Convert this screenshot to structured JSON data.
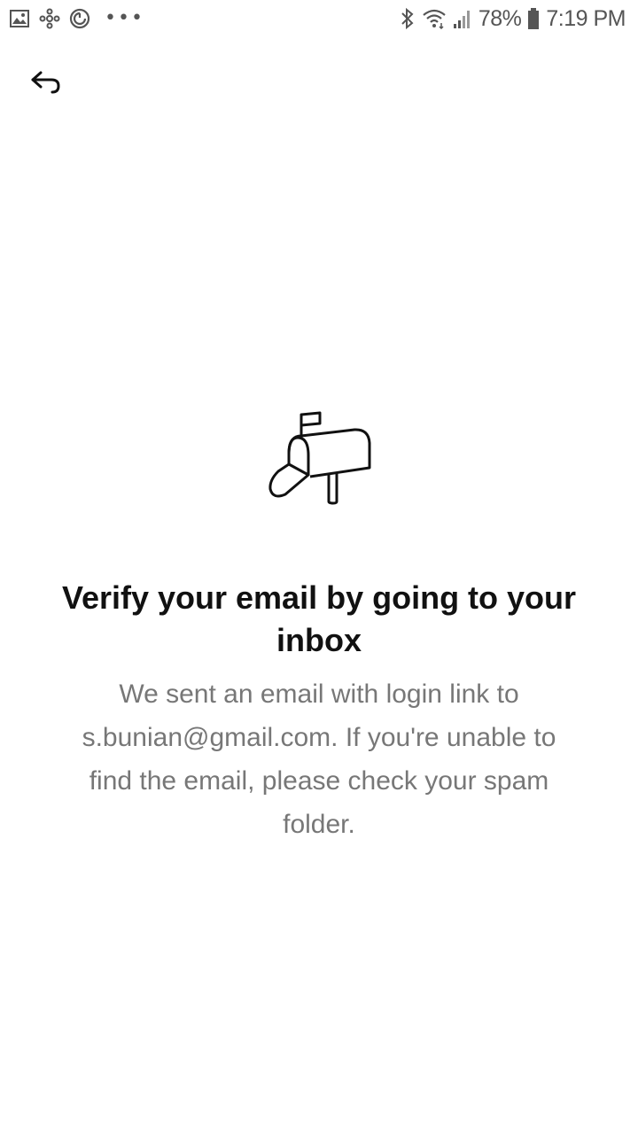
{
  "status_bar": {
    "battery_percent": "78%",
    "time": "7:19 PM",
    "left_icons": [
      "image-icon",
      "pinwheel-icon",
      "sync-icon",
      "more-dots-icon"
    ],
    "right_icons": [
      "bluetooth-icon",
      "wifi-icon",
      "signal-icon",
      "battery-icon"
    ]
  },
  "header": {
    "back_icon": "back-arrow-icon"
  },
  "main": {
    "illustration": "mailbox-icon",
    "title": "Verify your email by going to your inbox",
    "message": "We sent an email with login link to s.bunian@gmail.com. If you're unable to find the email, please check your spam folder."
  },
  "colors": {
    "background": "#ffffff",
    "title": "#111111",
    "body_text": "#777777",
    "status": "#555555"
  }
}
